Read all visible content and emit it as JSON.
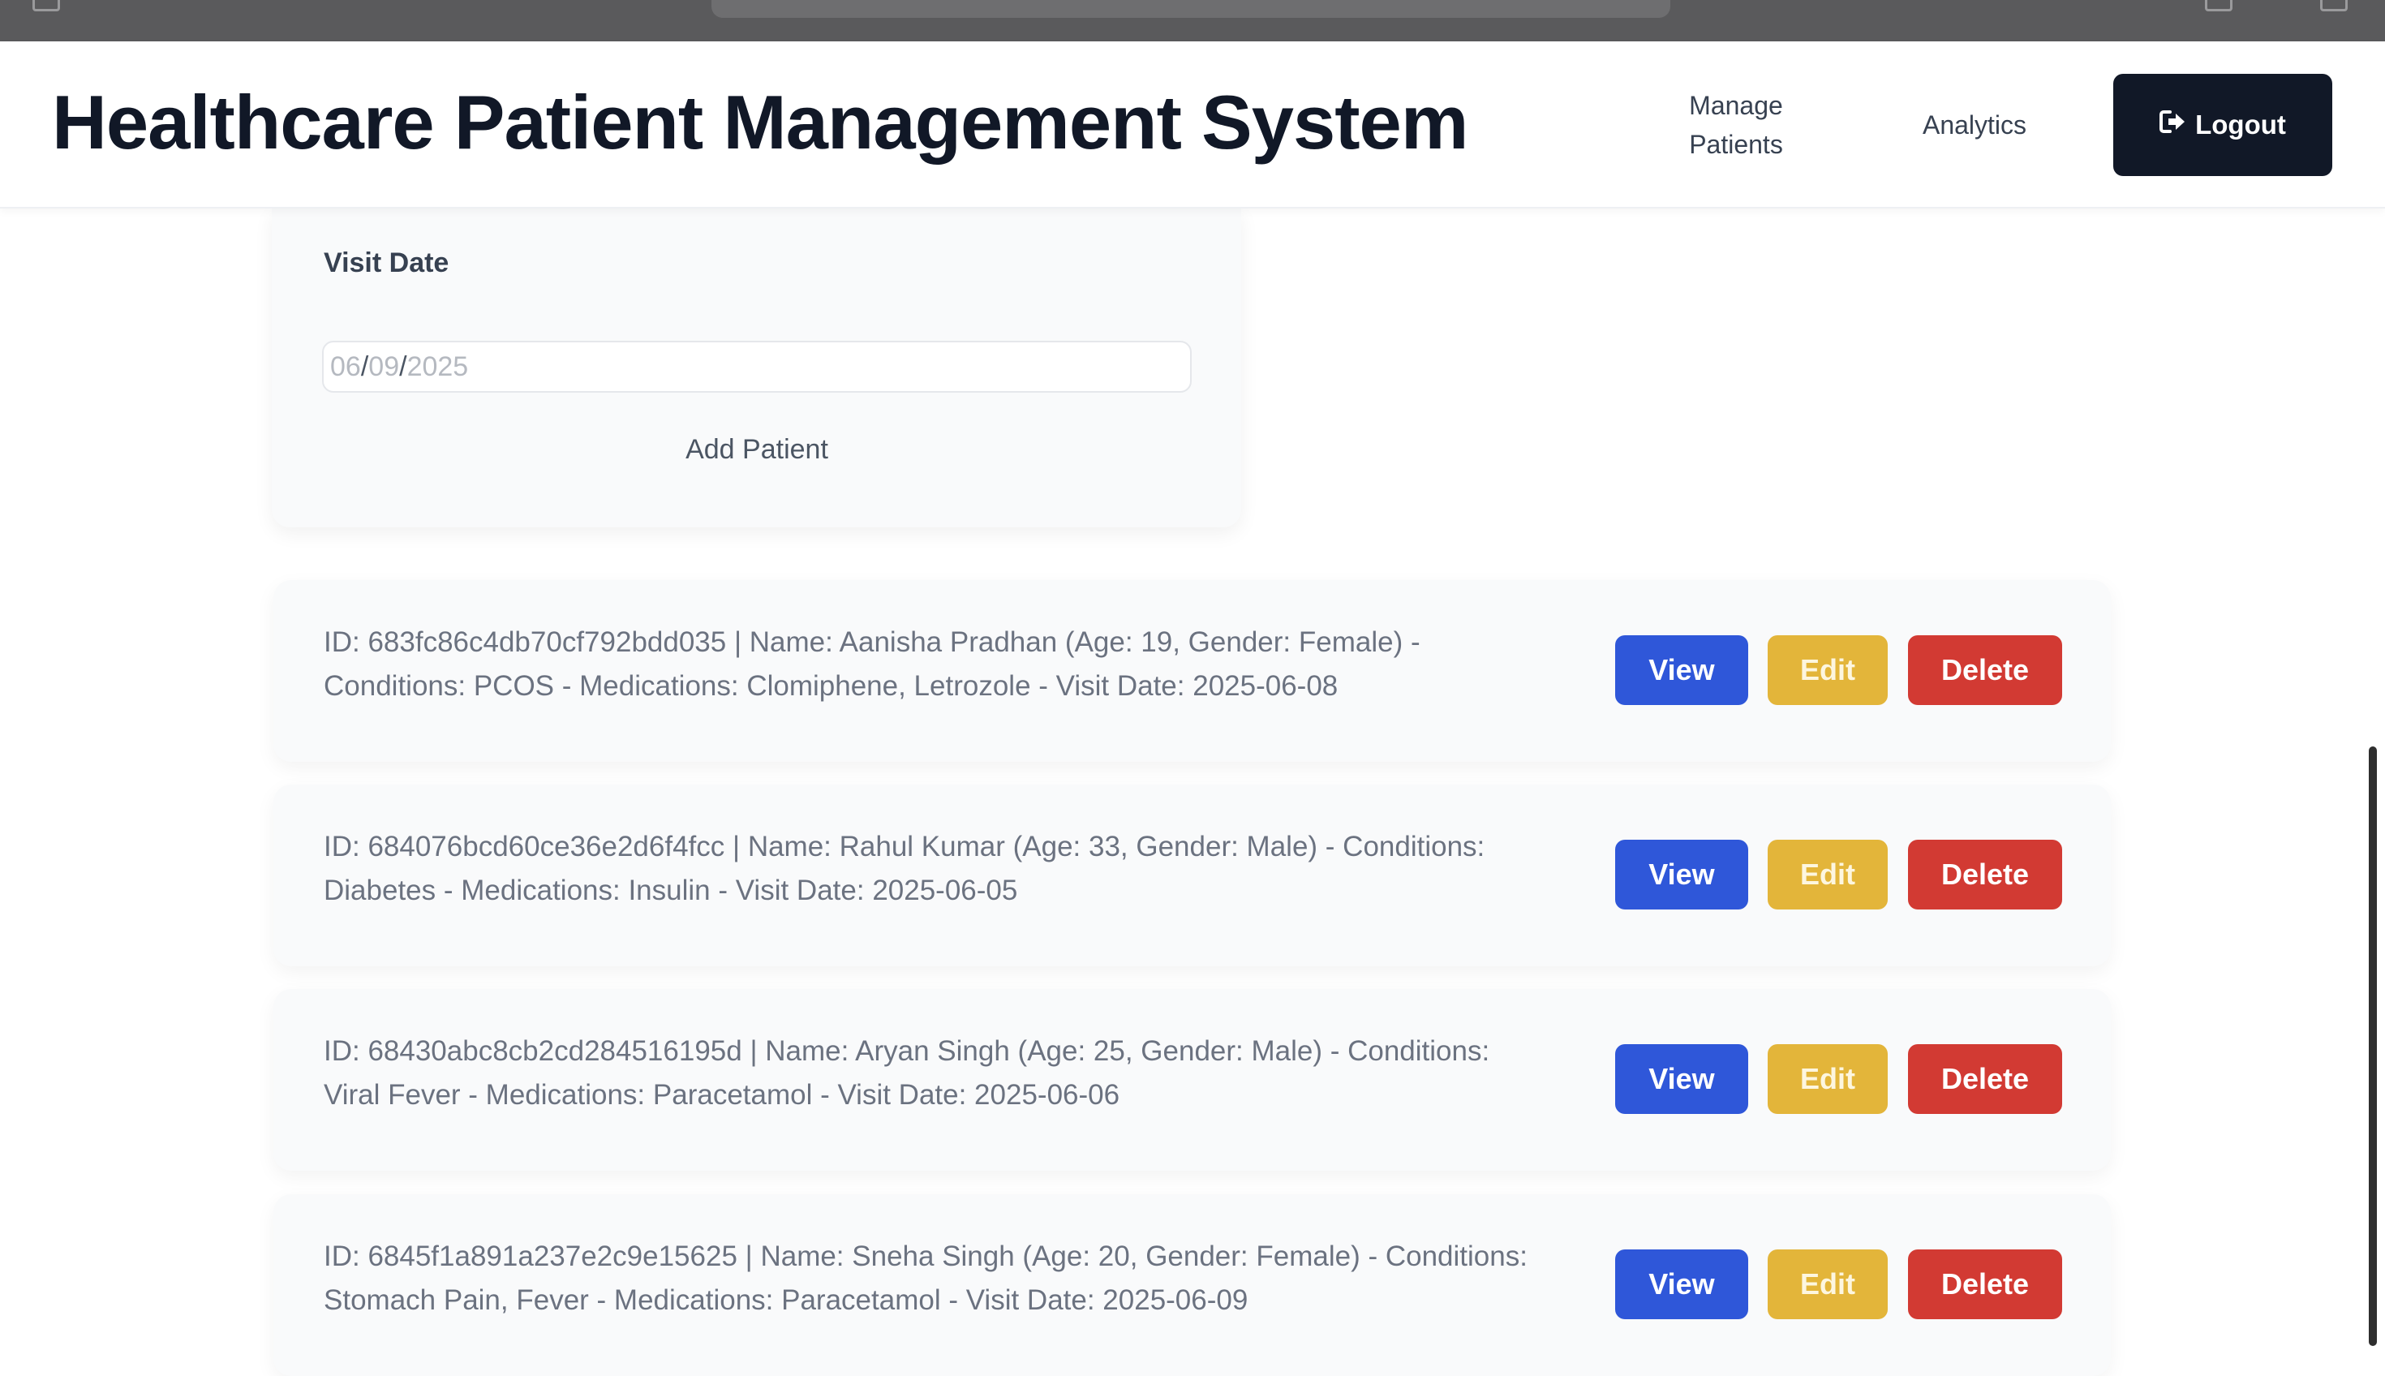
{
  "header": {
    "title": "Healthcare Patient Management System",
    "nav": {
      "manage_line1": "Manage",
      "manage_line2": "Patients",
      "analytics": "Analytics"
    },
    "logout_label": "Logout"
  },
  "form": {
    "visit_date_label": "Visit Date",
    "visit_date": {
      "month": "06",
      "day": "09",
      "year": "2025",
      "sep": "/"
    },
    "add_button_label": "Add Patient"
  },
  "patients": [
    {
      "line1": "ID: 683fc86c4db70cf792bdd035 | Name: Aanisha Pradhan (Age: 19, Gender: Female) -",
      "line2": "Conditions: PCOS - Medications: Clomiphene, Letrozole - Visit Date: 2025-06-08"
    },
    {
      "line1": "ID: 684076bcd60ce36e2d6f4fcc | Name: Rahul Kumar (Age: 33, Gender: Male) - Conditions:",
      "line2": "Diabetes - Medications: Insulin - Visit Date: 2025-06-05"
    },
    {
      "line1": "ID: 68430abc8cb2cd284516195d | Name: Aryan Singh (Age: 25, Gender: Male) - Conditions:",
      "line2": "Viral Fever - Medications: Paracetamol - Visit Date: 2025-06-06"
    },
    {
      "line1": "ID: 6845f1a891a237e2c9e15625 | Name: Sneha Singh (Age: 20, Gender: Female) - Conditions:",
      "line2": "Stomach Pain, Fever - Medications: Paracetamol - Visit Date: 2025-06-09"
    }
  ],
  "actions": {
    "view_label": "View",
    "edit_label": "Edit",
    "delete_label": "Delete"
  },
  "colors": {
    "view": "#2f57d9",
    "edit": "#e3b53a",
    "delete": "#d23a33",
    "logout": "#111827"
  },
  "icons": {
    "logout": "logout-icon"
  }
}
